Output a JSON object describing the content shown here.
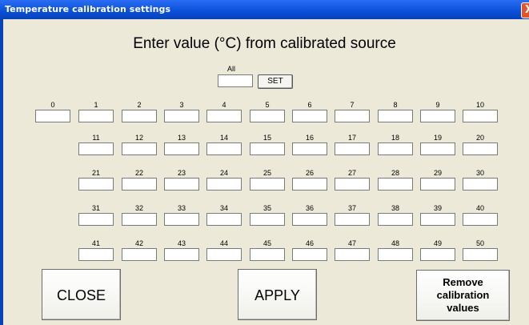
{
  "window": {
    "title": "Temperature calibration settings",
    "close_glyph": "X"
  },
  "heading": "Enter value (°C) from calibrated source",
  "all": {
    "label": "All",
    "value": "",
    "set_label": "SET"
  },
  "channels": [
    "0",
    "1",
    "2",
    "3",
    "4",
    "5",
    "6",
    "7",
    "8",
    "9",
    "10",
    "11",
    "12",
    "13",
    "14",
    "15",
    "16",
    "17",
    "18",
    "19",
    "20",
    "21",
    "22",
    "23",
    "24",
    "25",
    "26",
    "27",
    "28",
    "29",
    "30",
    "31",
    "32",
    "33",
    "34",
    "35",
    "36",
    "37",
    "38",
    "39",
    "40",
    "41",
    "42",
    "43",
    "44",
    "45",
    "46",
    "47",
    "48",
    "49",
    "50"
  ],
  "buttons": {
    "close": "CLOSE",
    "apply": "APPLY",
    "remove": "Remove calibration values"
  }
}
